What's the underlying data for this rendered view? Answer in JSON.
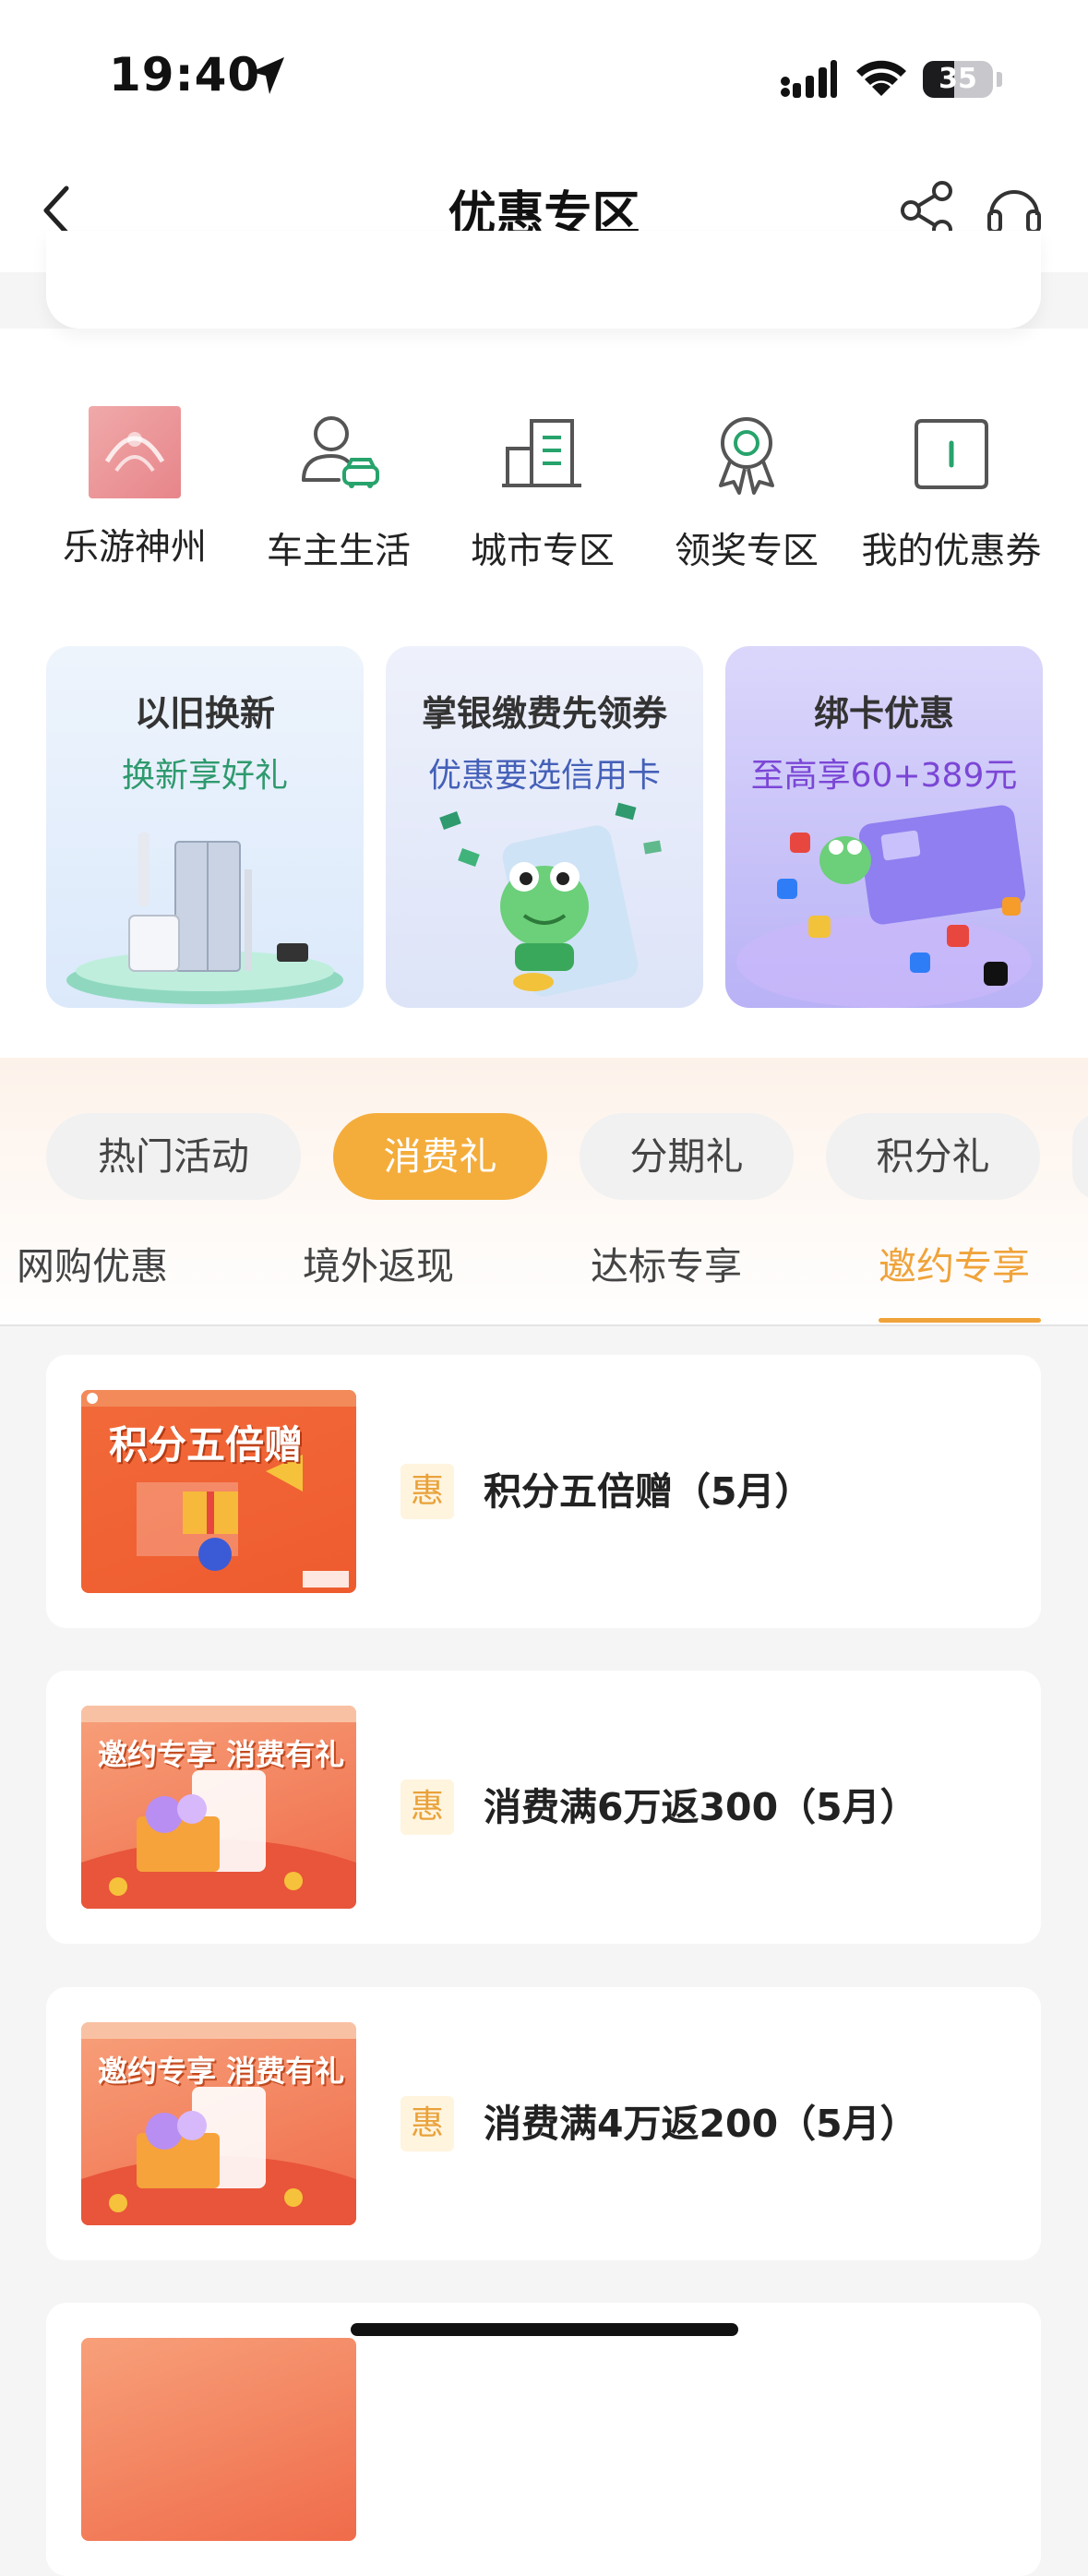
{
  "status_bar": {
    "time": "19:40",
    "battery": "35"
  },
  "header": {
    "title": "优惠专区"
  },
  "quick_items": [
    {
      "label": "乐游神州",
      "icon": "travel-logo-icon"
    },
    {
      "label": "车主生活",
      "icon": "car-owner-icon"
    },
    {
      "label": "城市专区",
      "icon": "city-building-icon"
    },
    {
      "label": "领奖专区",
      "icon": "award-badge-icon"
    },
    {
      "label": "我的优惠券",
      "icon": "coupon-icon"
    }
  ],
  "banners": [
    {
      "title": "以旧换新",
      "subtitle": "换新享好礼"
    },
    {
      "title": "掌银缴费先领券",
      "subtitle": "优惠要选信用卡"
    },
    {
      "title": "绑卡优惠",
      "subtitle": "至高享60+389元"
    }
  ],
  "pills": [
    {
      "label": "热门活动",
      "active": false
    },
    {
      "label": "消费礼",
      "active": true
    },
    {
      "label": "分期礼",
      "active": false
    },
    {
      "label": "积分礼",
      "active": false
    }
  ],
  "tabs": [
    {
      "label": "网购优惠",
      "active": false
    },
    {
      "label": "境外返现",
      "active": false
    },
    {
      "label": "达标专享",
      "active": false
    },
    {
      "label": "邀约专享",
      "active": true
    }
  ],
  "offers": [
    {
      "badge": "惠",
      "title": "积分五倍赠（5月）",
      "thumb_text": "积分五倍赠"
    },
    {
      "badge": "惠",
      "title": "消费满6万返300（5月）",
      "thumb_text": "邀约专享 消费有礼"
    },
    {
      "badge": "惠",
      "title": "消费满4万返200（5月）",
      "thumb_text": "邀约专享 消费有礼"
    }
  ],
  "colors": {
    "accent": "#f4ad3b",
    "tab_active": "#f0a33a",
    "badge_bg": "#fff4de"
  }
}
